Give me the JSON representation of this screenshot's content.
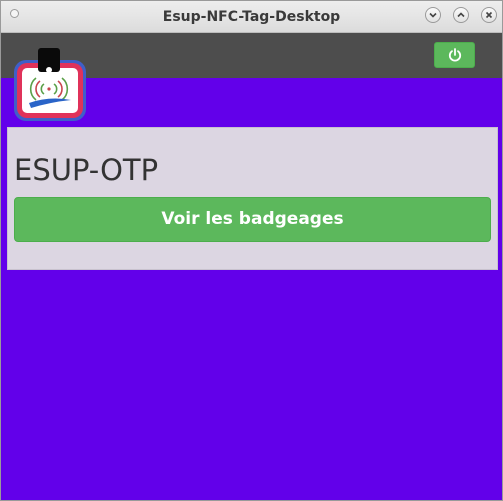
{
  "window": {
    "title": "Esup-NFC-Tag-Desktop"
  },
  "header": {
    "power_icon": "power-icon"
  },
  "panel": {
    "title": "ESUP-OTP",
    "button_label": "Voir les badgeages"
  },
  "colors": {
    "background": "#6200ea",
    "header": "#4d4d4d",
    "panel": "#dcd6e2",
    "button": "#5cb85c"
  }
}
